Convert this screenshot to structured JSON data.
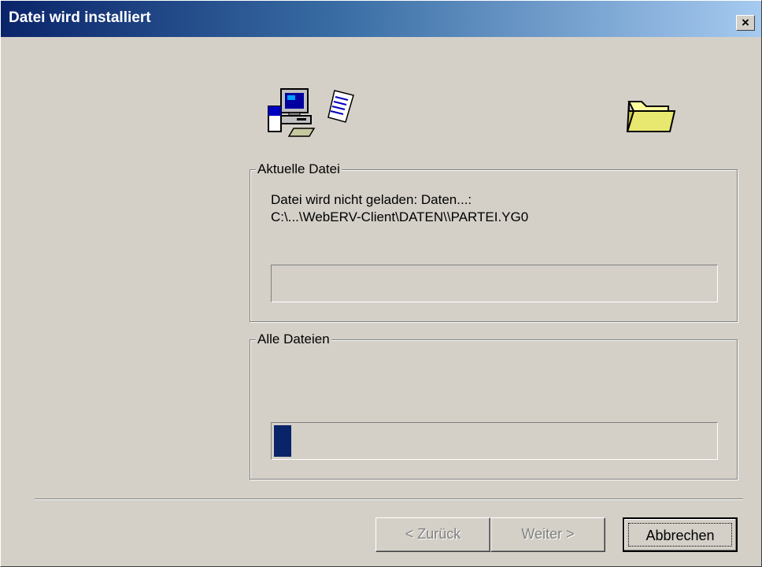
{
  "window": {
    "title": "Datei wird installiert",
    "close_label": "×"
  },
  "icons": {
    "computer": "computer-icon",
    "document": "document-icon",
    "folder": "folder-icon"
  },
  "current_file": {
    "legend": "Aktuelle Datei",
    "line1": "Datei wird nicht geladen: Daten...:",
    "line2": "C:\\...\\WebERV-Client\\DATEN\\\\PARTEI.YG0",
    "progress": 0
  },
  "all_files": {
    "legend": "Alle Dateien",
    "progress": 0.04
  },
  "buttons": {
    "back": "< Zurück",
    "next": "Weiter >",
    "cancel": "Abbrechen"
  },
  "colors": {
    "progress_fill": "#0a246a",
    "title_start": "#0a246a",
    "title_end": "#a6caf0"
  }
}
